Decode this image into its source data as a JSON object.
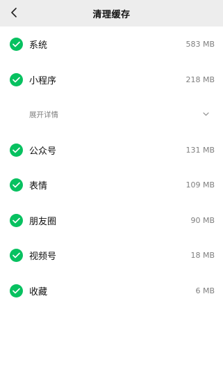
{
  "header": {
    "title": "清理缓存"
  },
  "items": [
    {
      "label": "系统",
      "size": "583 MB",
      "checked": true
    },
    {
      "label": "小程序",
      "size": "218 MB",
      "checked": true
    },
    {
      "label": "公众号",
      "size": "131 MB",
      "checked": true
    },
    {
      "label": "表情",
      "size": "109 MB",
      "checked": true
    },
    {
      "label": "朋友圈",
      "size": "90 MB",
      "checked": true
    },
    {
      "label": "视频号",
      "size": "18 MB",
      "checked": true
    },
    {
      "label": "收藏",
      "size": "6 MB",
      "checked": true
    }
  ],
  "expand": {
    "label": "展开详情"
  },
  "icons": {
    "back": "chevron-left-icon",
    "check": "check-circle-icon",
    "expand": "chevron-down-icon"
  },
  "colors": {
    "accent": "#07c160",
    "header_bg": "#ededed",
    "secondary_text": "#7f7f7f"
  }
}
